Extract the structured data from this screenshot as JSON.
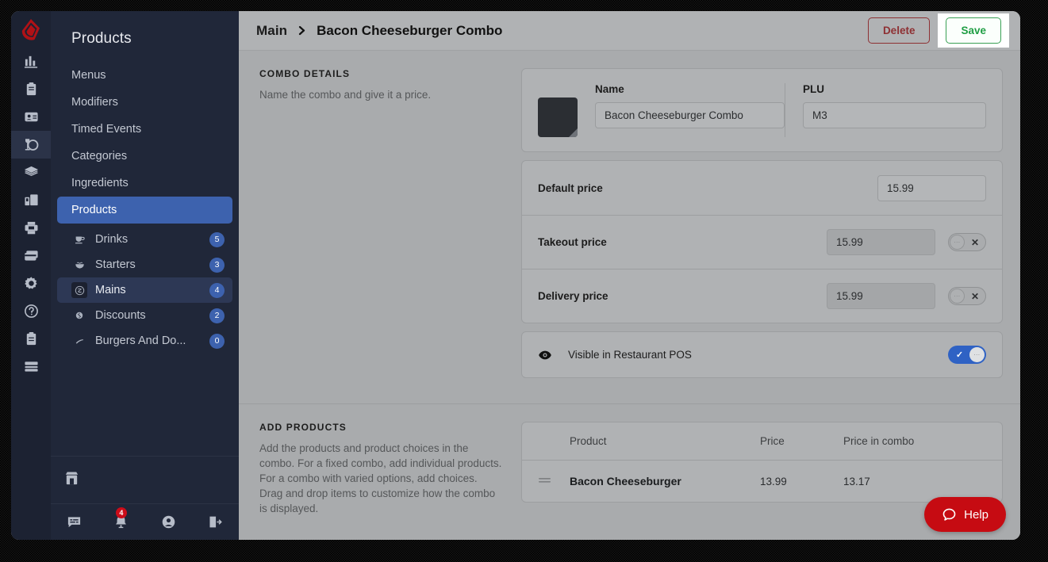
{
  "app": {
    "logo": "lightspeed-flame-logo"
  },
  "rail": {
    "items": [
      {
        "icon": "bar-chart-icon",
        "name": "reports",
        "active": false
      },
      {
        "icon": "clipboard-icon",
        "name": "orders",
        "active": false
      },
      {
        "icon": "contact-card-icon",
        "name": "customers",
        "active": false
      },
      {
        "icon": "restaurant-icon",
        "name": "restaurant",
        "active": true
      },
      {
        "icon": "layers-icon",
        "name": "inventory",
        "active": false
      },
      {
        "icon": "devices-icon",
        "name": "devices",
        "active": false
      },
      {
        "icon": "printer-icon",
        "name": "printers",
        "active": false
      },
      {
        "icon": "payment-cards-icon",
        "name": "payments",
        "active": false
      },
      {
        "icon": "gear-icon",
        "name": "settings",
        "active": false
      },
      {
        "icon": "question-circle-icon",
        "name": "help",
        "active": false
      },
      {
        "icon": "clipboard-list-icon",
        "name": "tasks",
        "active": false
      },
      {
        "icon": "server-list-icon",
        "name": "system",
        "active": false
      }
    ]
  },
  "sidebar": {
    "title": "Products",
    "nav": [
      {
        "label": "Menus",
        "active": false
      },
      {
        "label": "Modifiers",
        "active": false
      },
      {
        "label": "Timed Events",
        "active": false
      },
      {
        "label": "Categories",
        "active": false
      },
      {
        "label": "Ingredients",
        "active": false
      },
      {
        "label": "Products",
        "active": true
      }
    ],
    "categories": [
      {
        "label": "Drinks",
        "count": "5",
        "icon": "drink-cup-icon",
        "active": false
      },
      {
        "label": "Starters",
        "count": "3",
        "icon": "bowl-icon",
        "active": false
      },
      {
        "label": "Mains",
        "count": "4",
        "icon": "plate-cover-icon",
        "active": true
      },
      {
        "label": "Discounts",
        "count": "2",
        "icon": "tag-icon",
        "active": false
      },
      {
        "label": "Burgers And Do...",
        "count": "0",
        "icon": "hotdog-icon",
        "active": false
      }
    ],
    "store": {
      "icon": "storefront-icon",
      "name_redacted": "",
      "address_redacted": ""
    },
    "bottom": [
      {
        "icon": "chat-icon",
        "name": "messages",
        "badge": ""
      },
      {
        "icon": "bell-icon",
        "name": "notifications",
        "badge": "4"
      },
      {
        "icon": "user-circle-icon",
        "name": "account",
        "badge": ""
      },
      {
        "icon": "logout-icon",
        "name": "logout",
        "badge": ""
      }
    ]
  },
  "topbar": {
    "breadcrumb_root": "Main",
    "breadcrumb_sep": "›",
    "breadcrumb_current": "Bacon Cheeseburger Combo",
    "delete_label": "Delete",
    "save_label": "Save"
  },
  "combo_details": {
    "section_title": "COMBO DETAILS",
    "section_desc": "Name the combo and give it a price.",
    "color_swatch": "#2b2e33",
    "name_label": "Name",
    "name_value": "Bacon Cheeseburger Combo",
    "plu_label": "PLU",
    "plu_value": "M3",
    "prices": [
      {
        "label": "Default price",
        "value": "15.99",
        "has_toggle": false,
        "toggle_on": false
      },
      {
        "label": "Takeout price",
        "value": "15.99",
        "has_toggle": true,
        "toggle_on": false
      },
      {
        "label": "Delivery price",
        "value": "15.99",
        "has_toggle": true,
        "toggle_on": false
      }
    ],
    "visibility": {
      "icon": "eye-icon",
      "label": "Visible in Restaurant POS",
      "toggle_on": true,
      "toggle_on_color": "#2f62c4"
    }
  },
  "add_products": {
    "section_title": "ADD PRODUCTS",
    "section_desc": "Add the products and product choices in the combo. For a fixed combo, add individual products. For a combo with varied options, add choices. Drag and drop items to customize how the combo is displayed.",
    "columns": [
      "Product",
      "Price",
      "Price in combo"
    ],
    "rows": [
      {
        "handle": "drag-handle",
        "product": "Bacon Cheeseburger",
        "price": "13.99",
        "price_in_combo": "13.17"
      }
    ]
  },
  "help_widget": {
    "label": "Help",
    "icon": "chat-bubble-icon",
    "color": "#c60b12"
  }
}
